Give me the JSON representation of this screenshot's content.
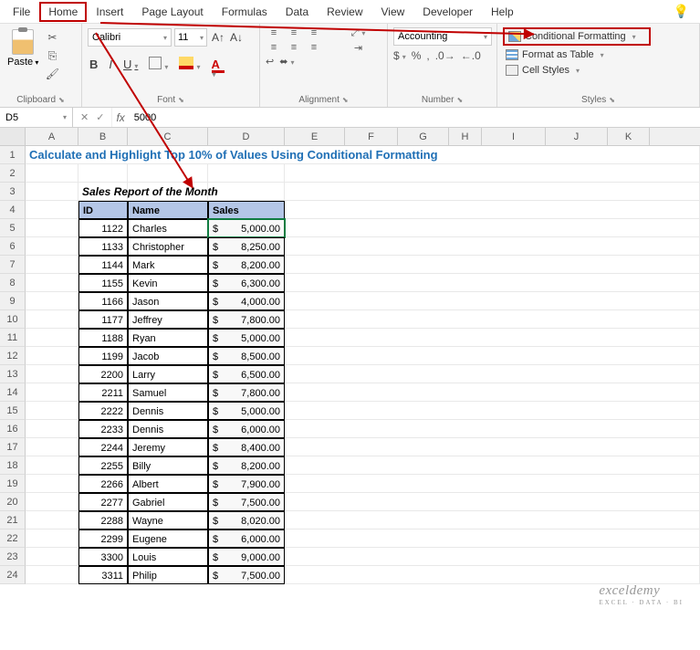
{
  "menu": {
    "file": "File",
    "home": "Home",
    "insert": "Insert",
    "pageLayout": "Page Layout",
    "formulas": "Formulas",
    "data": "Data",
    "review": "Review",
    "view": "View",
    "developer": "Developer",
    "help": "Help"
  },
  "ribbon": {
    "clipboard": {
      "label": "Clipboard",
      "paste": "Paste"
    },
    "font": {
      "label": "Font",
      "name": "Calibri",
      "size": "11",
      "bold": "B",
      "italic": "I",
      "underline": "U",
      "fontColor": "A"
    },
    "align": {
      "label": "Alignment"
    },
    "number": {
      "label": "Number",
      "format": "Accounting",
      "currency": "$",
      "percent": "%",
      "comma": ","
    },
    "styles": {
      "label": "Styles",
      "cf": "Conditional Formatting",
      "ft": "Format as Table",
      "cs": "Cell Styles"
    }
  },
  "namebox": "D5",
  "fxlabel": "fx",
  "fxvalue": "5000",
  "cols": [
    "A",
    "B",
    "C",
    "D",
    "E",
    "F",
    "G",
    "H",
    "I",
    "J",
    "K"
  ],
  "title": "Calculate and Highlight Top 10% of Values Using Conditional Formatting",
  "subtitle": "Sales Report of the Month",
  "headers": {
    "id": "ID",
    "name": "Name",
    "sales": "Sales"
  },
  "rows": [
    {
      "id": "1122",
      "name": "Charles",
      "sales": "5,000.00"
    },
    {
      "id": "1133",
      "name": "Christopher",
      "sales": "8,250.00"
    },
    {
      "id": "1144",
      "name": "Mark",
      "sales": "8,200.00"
    },
    {
      "id": "1155",
      "name": "Kevin",
      "sales": "6,300.00"
    },
    {
      "id": "1166",
      "name": "Jason",
      "sales": "4,000.00"
    },
    {
      "id": "1177",
      "name": "Jeffrey",
      "sales": "7,800.00"
    },
    {
      "id": "1188",
      "name": "Ryan",
      "sales": "5,000.00"
    },
    {
      "id": "1199",
      "name": "Jacob",
      "sales": "8,500.00"
    },
    {
      "id": "2200",
      "name": "Larry",
      "sales": "6,500.00"
    },
    {
      "id": "2211",
      "name": "Samuel",
      "sales": "7,800.00"
    },
    {
      "id": "2222",
      "name": "Dennis",
      "sales": "5,000.00"
    },
    {
      "id": "2233",
      "name": "Dennis",
      "sales": "6,000.00"
    },
    {
      "id": "2244",
      "name": "Jeremy",
      "sales": "8,400.00"
    },
    {
      "id": "2255",
      "name": "Billy",
      "sales": "8,200.00"
    },
    {
      "id": "2266",
      "name": "Albert",
      "sales": "7,900.00"
    },
    {
      "id": "2277",
      "name": "Gabriel",
      "sales": "7,500.00"
    },
    {
      "id": "2288",
      "name": "Wayne",
      "sales": "8,020.00"
    },
    {
      "id": "2299",
      "name": "Eugene",
      "sales": "6,000.00"
    },
    {
      "id": "3300",
      "name": "Louis",
      "sales": "9,000.00"
    },
    {
      "id": "3311",
      "name": "Philip",
      "sales": "7,500.00"
    }
  ],
  "watermark": {
    "line1": "exceldemy",
    "line2": "EXCEL · DATA · BI"
  }
}
